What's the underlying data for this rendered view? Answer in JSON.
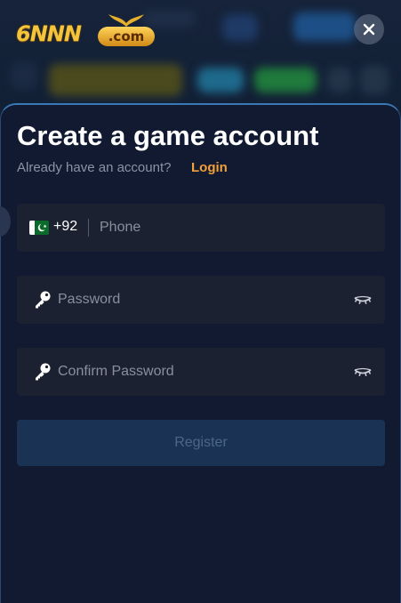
{
  "logo": {
    "main_text": "6NNN",
    "suffix_text": ".com"
  },
  "modal": {
    "title": "Create a game account",
    "subtitle": "Already have an account?",
    "login_link": "Login"
  },
  "form": {
    "phone": {
      "country_code": "+92",
      "placeholder": "Phone",
      "flag_icon": "pakistan-flag-icon"
    },
    "password": {
      "placeholder": "Password",
      "icon": "key-icon",
      "toggle_icon": "eye-closed-icon"
    },
    "confirm_password": {
      "placeholder": "Confirm Password",
      "icon": "key-icon",
      "toggle_icon": "eye-closed-icon"
    },
    "register_label": "Register"
  },
  "colors": {
    "accent": "#f2a03a",
    "sheet_bg": "#111a30",
    "field_bg": "#1b2130",
    "button_bg": "#1a3354"
  }
}
